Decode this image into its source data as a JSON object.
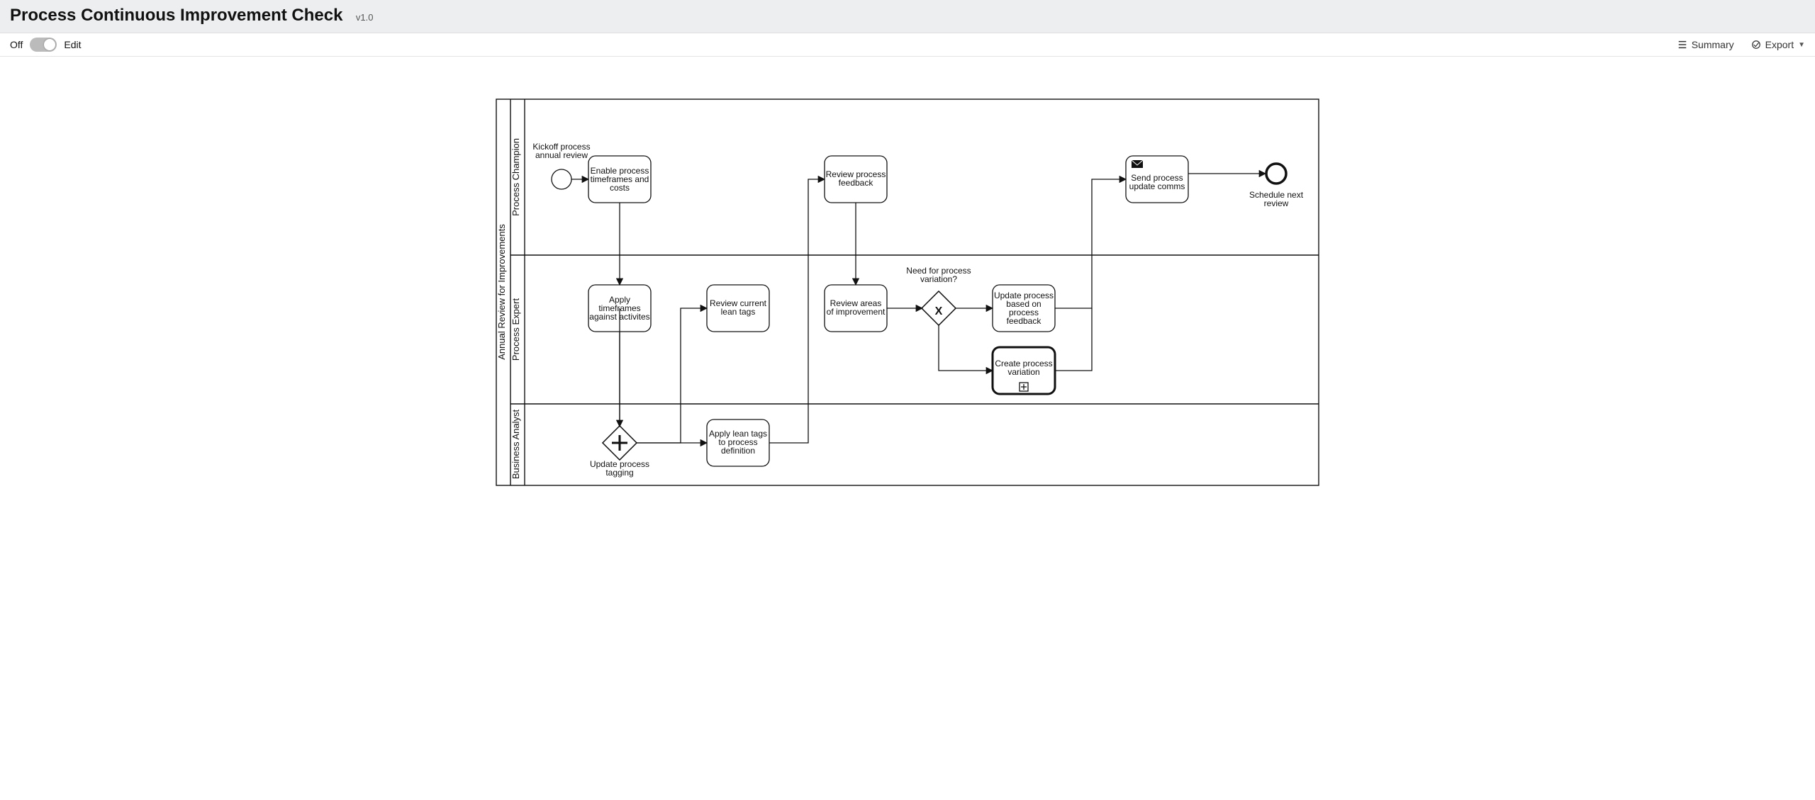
{
  "header": {
    "title": "Process Continuous Improvement Check",
    "version": "v1.0"
  },
  "toolbar": {
    "offLabel": "Off",
    "editLabel": "Edit",
    "summaryLabel": "Summary",
    "exportLabel": "Export"
  },
  "pool": {
    "title": "Annual Review for Improvements"
  },
  "lanes": {
    "l1": "Process Champion",
    "l2": "Process Expert",
    "l3": "Business Analyst"
  },
  "nodes": {
    "startLabel": "Kickoff process annual review",
    "t1": "Enable process timeframes and costs",
    "t2": "Review process feedback",
    "t3": "Send process update comms",
    "endLabel": "Schedule next review",
    "t4": "Apply timeframes against activites",
    "t5": "Review current lean tags",
    "t6": "Review areas of improvement",
    "gwLabel": "Need for process variation?",
    "t7": "Update process based on process feedback",
    "t8": "Create process variation",
    "gw2Label": "Update process tagging",
    "t9": "Apply lean tags to process definition"
  },
  "chart_data": {
    "type": "bpmn",
    "pool": "Annual Review for Improvements",
    "lanes": [
      "Process Champion",
      "Process Expert",
      "Business Analyst"
    ],
    "elements": [
      {
        "id": "start",
        "type": "startEvent",
        "lane": "Process Champion",
        "label": "Kickoff process annual review"
      },
      {
        "id": "t1",
        "type": "task",
        "lane": "Process Champion",
        "label": "Enable process timeframes and costs"
      },
      {
        "id": "t2",
        "type": "task",
        "lane": "Process Champion",
        "label": "Review process feedback"
      },
      {
        "id": "t3",
        "type": "sendTask",
        "lane": "Process Champion",
        "label": "Send process update comms",
        "marker": "message"
      },
      {
        "id": "end",
        "type": "endEvent",
        "lane": "Process Champion",
        "label": "Schedule next review"
      },
      {
        "id": "t4",
        "type": "task",
        "lane": "Process Expert",
        "label": "Apply timeframes against activites"
      },
      {
        "id": "t5",
        "type": "task",
        "lane": "Process Expert",
        "label": "Review current lean tags"
      },
      {
        "id": "t6",
        "type": "task",
        "lane": "Process Expert",
        "label": "Review areas of improvement"
      },
      {
        "id": "gw1",
        "type": "exclusiveGateway",
        "lane": "Process Expert",
        "label": "Need for process variation?"
      },
      {
        "id": "t7",
        "type": "task",
        "lane": "Process Expert",
        "label": "Update process based on process feedback"
      },
      {
        "id": "t8",
        "type": "subprocess",
        "lane": "Process Expert",
        "label": "Create process variation",
        "marker": "expand"
      },
      {
        "id": "gw2",
        "type": "parallelGateway",
        "lane": "Business Analyst",
        "label": "Update process tagging"
      },
      {
        "id": "t9",
        "type": "task",
        "lane": "Business Analyst",
        "label": "Apply lean tags to process definition"
      }
    ],
    "flows": [
      {
        "from": "start",
        "to": "t1"
      },
      {
        "from": "t1",
        "to": "t4"
      },
      {
        "from": "t4",
        "to": "gw2"
      },
      {
        "from": "gw2",
        "to": "t9"
      },
      {
        "from": "gw2",
        "to": "t5"
      },
      {
        "from": "t9",
        "to": "t2"
      },
      {
        "from": "t5",
        "to": "t2"
      },
      {
        "from": "t2",
        "to": "t6"
      },
      {
        "from": "t6",
        "to": "gw1"
      },
      {
        "from": "gw1",
        "to": "t7"
      },
      {
        "from": "gw1",
        "to": "t8"
      },
      {
        "from": "t7",
        "to": "t3"
      },
      {
        "from": "t8",
        "to": "t3"
      },
      {
        "from": "t3",
        "to": "end"
      }
    ]
  }
}
